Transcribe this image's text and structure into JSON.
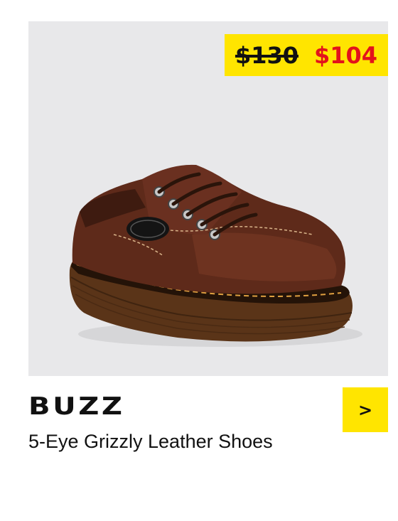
{
  "product": {
    "name": "BUZZ",
    "description": "5-Eye Grizzly Leather Shoes",
    "price_original": "$130",
    "price_sale": "$104",
    "image_icon": "brown-leather-shoe-image"
  },
  "actions": {
    "open_label": ">"
  },
  "colors": {
    "badge": "#ffe500",
    "sale": "#e3121b",
    "image_bg": "#e8e8ea"
  }
}
